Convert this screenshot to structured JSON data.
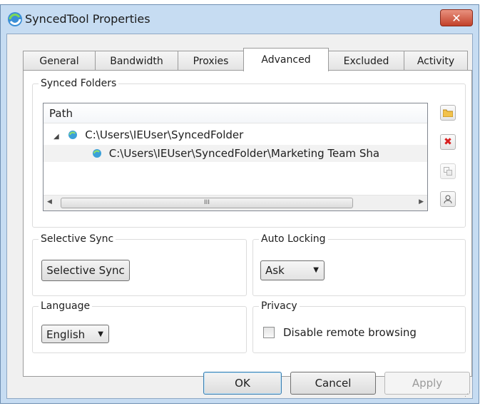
{
  "window": {
    "title": "SyncedTool Properties",
    "close_label": "✕"
  },
  "tabs": [
    {
      "label": "General"
    },
    {
      "label": "Bandwidth"
    },
    {
      "label": "Proxies"
    },
    {
      "label": "Advanced"
    },
    {
      "label": "Excluded"
    },
    {
      "label": "Activity"
    }
  ],
  "active_tab": "Advanced",
  "synced_folders": {
    "title": "Synced Folders",
    "column_header": "Path",
    "rows": [
      {
        "path": "C:\\Users\\IEUser\\SyncedFolder",
        "expanded": true
      },
      {
        "path": "C:\\Users\\IEUser\\SyncedFolder\\Marketing Team Sha",
        "selected": true
      }
    ],
    "scroll_thumb_label": "III",
    "side_buttons": [
      "folder-icon",
      "delete-icon",
      "copy-icon",
      "user-icon"
    ]
  },
  "selective_sync": {
    "title": "Selective Sync",
    "button_label": "Selective Sync"
  },
  "auto_locking": {
    "title": "Auto Locking",
    "value": "Ask"
  },
  "language": {
    "title": "Language",
    "value": "English"
  },
  "privacy": {
    "title": "Privacy",
    "checkbox_label": "Disable remote browsing",
    "checked": false
  },
  "footer": {
    "ok_label": "OK",
    "cancel_label": "Cancel",
    "apply_label": "Apply"
  },
  "colors": {
    "accent": "#c6dcf2",
    "close": "#c2412a",
    "folder_icon": "#f2c24b",
    "delete_icon": "#d81e1e"
  }
}
